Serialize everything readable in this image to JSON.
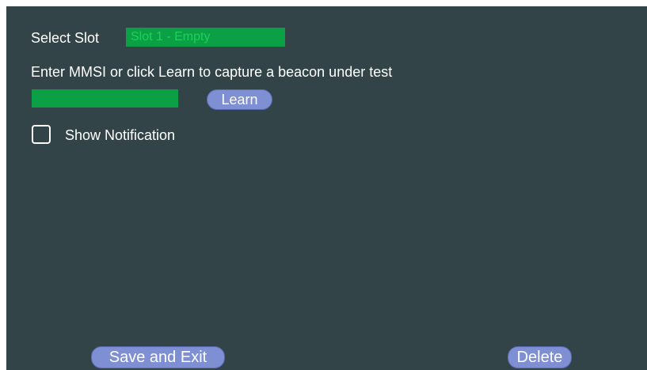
{
  "slot": {
    "label": "Select Slot",
    "selected_value": "Slot 1 - Empty"
  },
  "mmsi": {
    "instruction": "Enter MMSI or click Learn to capture  a beacon under test",
    "value": "",
    "placeholder": "",
    "learn_label": "Learn"
  },
  "notification": {
    "label": "Show Notification",
    "checked": false
  },
  "footer": {
    "save_label": "Save and Exit",
    "delete_label": "Delete"
  },
  "colors": {
    "background": "#324447",
    "field_green": "#0ba045",
    "button_blue": "#7e8fd4"
  }
}
